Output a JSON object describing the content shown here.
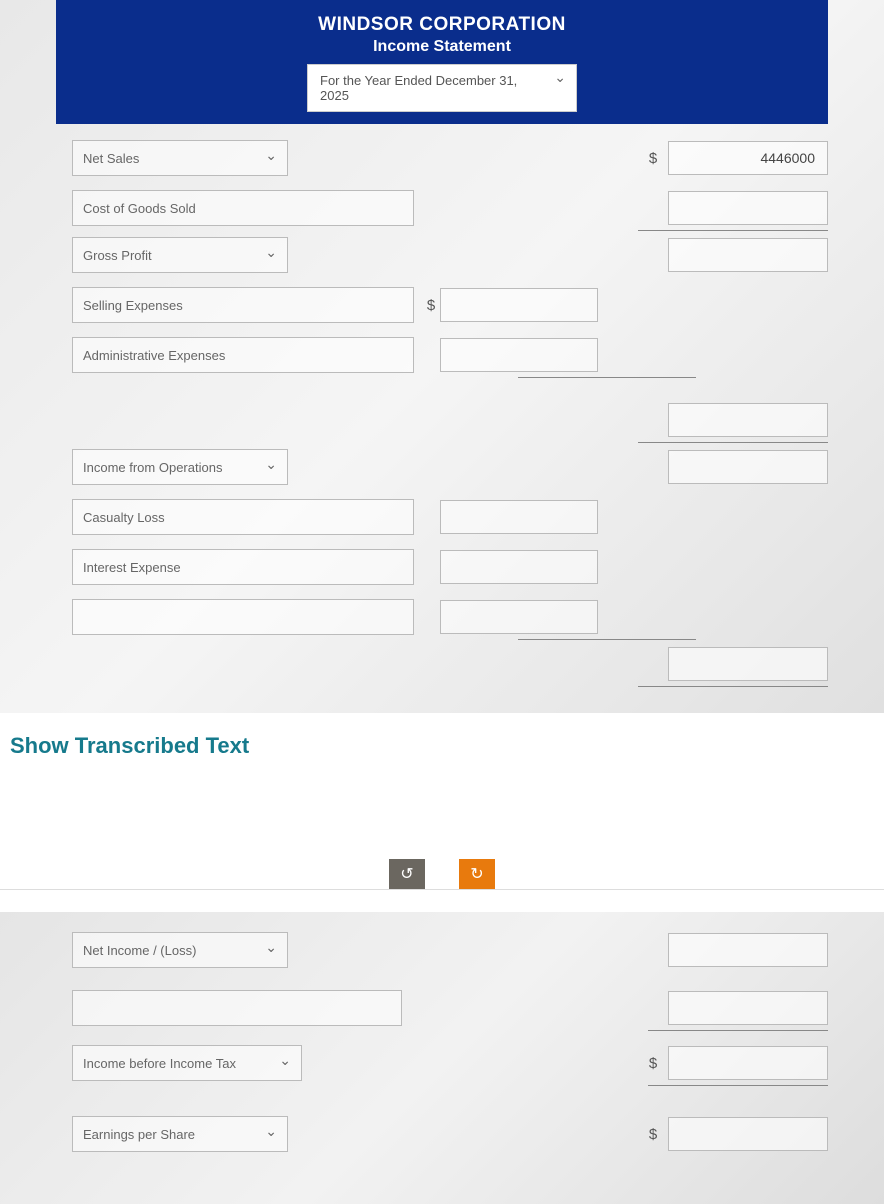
{
  "header": {
    "company": "WINDSOR CORPORATION",
    "statement": "Income Statement",
    "period": "For the Year Ended December 31, 2025"
  },
  "rows": {
    "net_sales": "Net Sales",
    "cogs": "Cost of Goods Sold",
    "gross_profit": "Gross Profit",
    "selling_exp": "Selling Expenses",
    "admin_exp": "Administrative Expenses",
    "income_ops": "Income from Operations",
    "casualty": "Casualty Loss",
    "interest": "Interest Expense",
    "net_income": "Net Income / (Loss)",
    "income_before_tax": "Income before Income Tax",
    "eps": "Earnings per Share"
  },
  "values": {
    "net_sales_amount": "4446000"
  },
  "symbols": {
    "dollar": "$"
  },
  "link": {
    "transcribed": "Show Transcribed Text"
  },
  "nav": {
    "prev": "↺",
    "next": "↻"
  }
}
